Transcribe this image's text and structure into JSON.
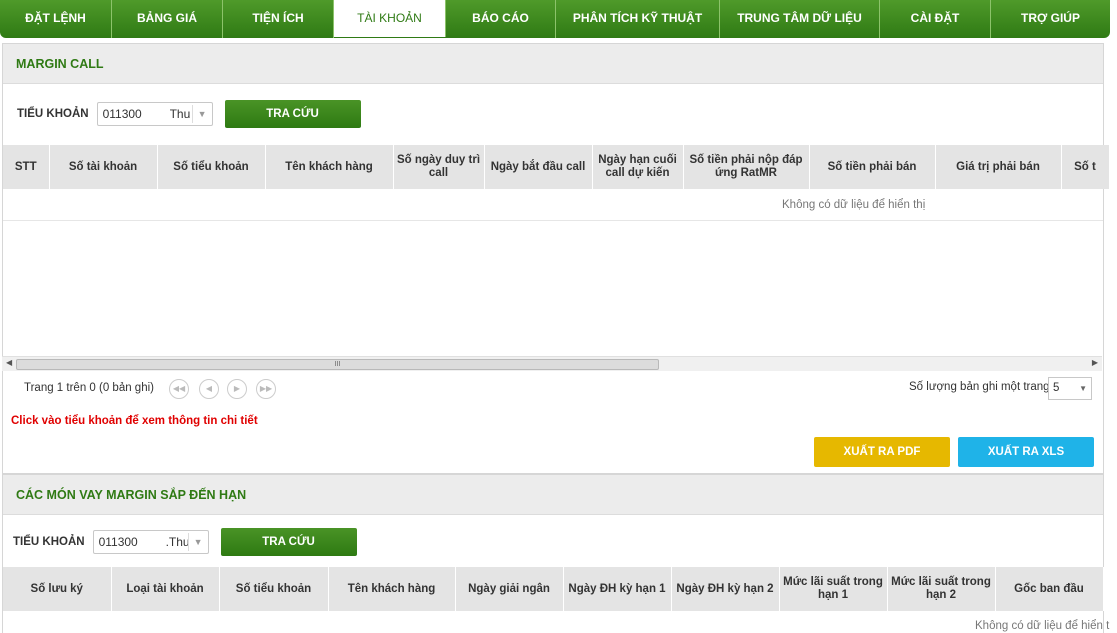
{
  "nav": {
    "items": [
      "ĐẶT LỆNH",
      "BẢNG GIÁ",
      "TIỆN ÍCH",
      "TÀI KHOẢN",
      "BÁO CÁO",
      "PHÂN TÍCH KỸ THUẬT",
      "TRUNG TÂM DỮ LIỆU",
      "CÀI ĐẶT",
      "TRỢ GIÚP"
    ],
    "active": "TÀI KHOẢN"
  },
  "margin_call": {
    "title": "MARGIN CALL",
    "subaccount_label": "TIỂU KHOẢN",
    "subaccount_value": "011300",
    "subaccount_name": "Thu",
    "search_label": "TRA CỨU",
    "columns": [
      "STT",
      "Số tài khoản",
      "Số tiểu khoản",
      "Tên khách hàng",
      "Số ngày duy trì call",
      "Ngày bắt đầu call",
      "Ngày hạn cuối call dự kiến",
      "Số tiền phải nộp đáp ứng RatMR",
      "Số tiền phải bán",
      "Giá trị phải bán",
      "Số t"
    ],
    "empty_text": "Không có dữ liệu để hiển thị",
    "scroll_thumb": "III",
    "pager": {
      "summary": "Trang 1 trên 0 (0 bản ghi)",
      "per_page_label": "Số lượng bản ghi một trang",
      "per_page_value": "5"
    },
    "hint": "Click vào tiểu khoản để xem thông tin chi tiết",
    "export_pdf": "XUẤT RA PDF",
    "export_xls": "XUẤT RA XLS"
  },
  "margin_loans": {
    "title": "CÁC MÓN VAY MARGIN SẮP ĐẾN HẠN",
    "subaccount_label": "TIỂU KHOẢN",
    "subaccount_value": "011300",
    "subaccount_name": ".Thu",
    "search_label": "TRA CỨU",
    "columns": [
      "Số lưu ký",
      "Loại tài khoản",
      "Số tiểu khoản",
      "Tên khách hàng",
      "Ngày giải ngân",
      "Ngày ĐH kỳ hạn 1",
      "Ngày ĐH kỳ hạn 2",
      "Mức lãi suất trong hạn 1",
      "Mức lãi suất trong hạn 2",
      "Gốc ban đầu"
    ],
    "empty_text": "Không có dữ liệu để hiển t"
  },
  "colors": {
    "brand_green": "#2f7a14",
    "pdf_button": "#e6b800",
    "xls_button": "#1fb3e8",
    "hint_red": "#e00000"
  }
}
